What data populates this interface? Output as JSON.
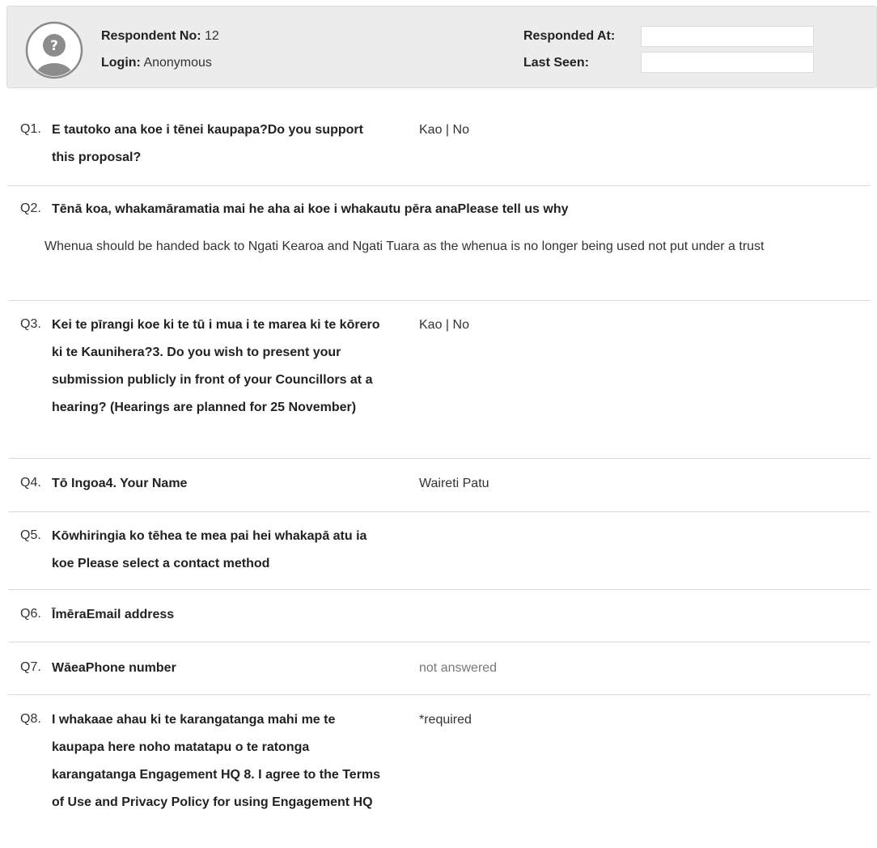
{
  "respondent": {
    "no_label": "Respondent No:",
    "no_value": "12",
    "login_label": "Login:",
    "login_value": "Anonymous",
    "responded_at_label": "Responded At:",
    "responded_at_value": "",
    "last_seen_label": "Last Seen:",
    "last_seen_value": ""
  },
  "questions": [
    {
      "num": "Q1.",
      "text": "E tautoko ana koe i tēnei kaupapa?Do you support this proposal?",
      "answer": "Kao | No"
    },
    {
      "num": "Q2.",
      "text": "Tēnā koa, whakamāramatia mai he aha ai koe i whakautu pēra anaPlease tell us why",
      "answer": "Whenua should be handed back to Ngati Kearoa and Ngati Tuara as the whenua is no longer being used not put under a trust"
    },
    {
      "num": "Q3.",
      "text": "Kei te pīrangi koe ki te tū i mua i te marea ki te kōrero ki te Kaunihera?3. Do you wish to present your submission publicly in front of your Councillors at a hearing?  (Hearings are planned for 25 November)",
      "answer": "Kao | No"
    },
    {
      "num": "Q4.",
      "text": "Tō Ingoa4. Your Name",
      "answer": "Waireti Patu"
    },
    {
      "num": "Q5.",
      "text": "Kōwhiringia ko tēhea te mea pai hei whakapā atu ia koe Please select a contact method",
      "answer": ""
    },
    {
      "num": "Q6.",
      "text": "ĪmēraEmail address",
      "answer": ""
    },
    {
      "num": "Q7.",
      "text": "WāeaPhone number",
      "answer": "not answered"
    },
    {
      "num": "Q8.",
      "text": "I whakaae ahau ki te karangatanga mahi me te kaupapa here noho matatapu o te ratonga karangatanga Engagement HQ 8. I agree to the Terms of Use and Privacy Policy for using Engagement HQ",
      "answer": "*required"
    }
  ]
}
